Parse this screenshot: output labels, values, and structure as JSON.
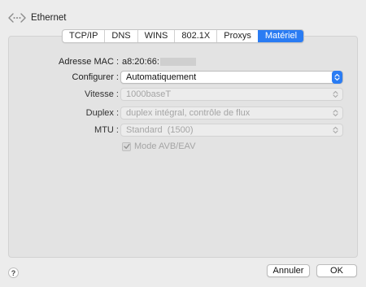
{
  "window": {
    "title": "Ethernet",
    "icon": "ethernet-icon"
  },
  "tabs": [
    {
      "label": "TCP/IP",
      "active": false
    },
    {
      "label": "DNS",
      "active": false
    },
    {
      "label": "WINS",
      "active": false
    },
    {
      "label": "802.1X",
      "active": false
    },
    {
      "label": "Proxys",
      "active": false
    },
    {
      "label": "Matériel",
      "active": true
    }
  ],
  "hardware": {
    "mac_label": "Adresse MAC :",
    "mac_value": "a8:20:66:",
    "configure_label": "Configurer :",
    "configure_value": "Automatiquement",
    "speed_label": "Vitesse :",
    "speed_value": "1000baseT",
    "duplex_label": "Duplex :",
    "duplex_value": "duplex intégral, contrôle de flux",
    "mtu_label": "MTU :",
    "mtu_value": "Standard  (1500)",
    "avb_label": "Mode AVB/EAV",
    "avb_checked": true
  },
  "footer": {
    "help": "?",
    "cancel": "Annuler",
    "ok": "OK"
  },
  "colors": {
    "accent": "#2a7cf3",
    "disabled_text": "#a5a5a5"
  }
}
